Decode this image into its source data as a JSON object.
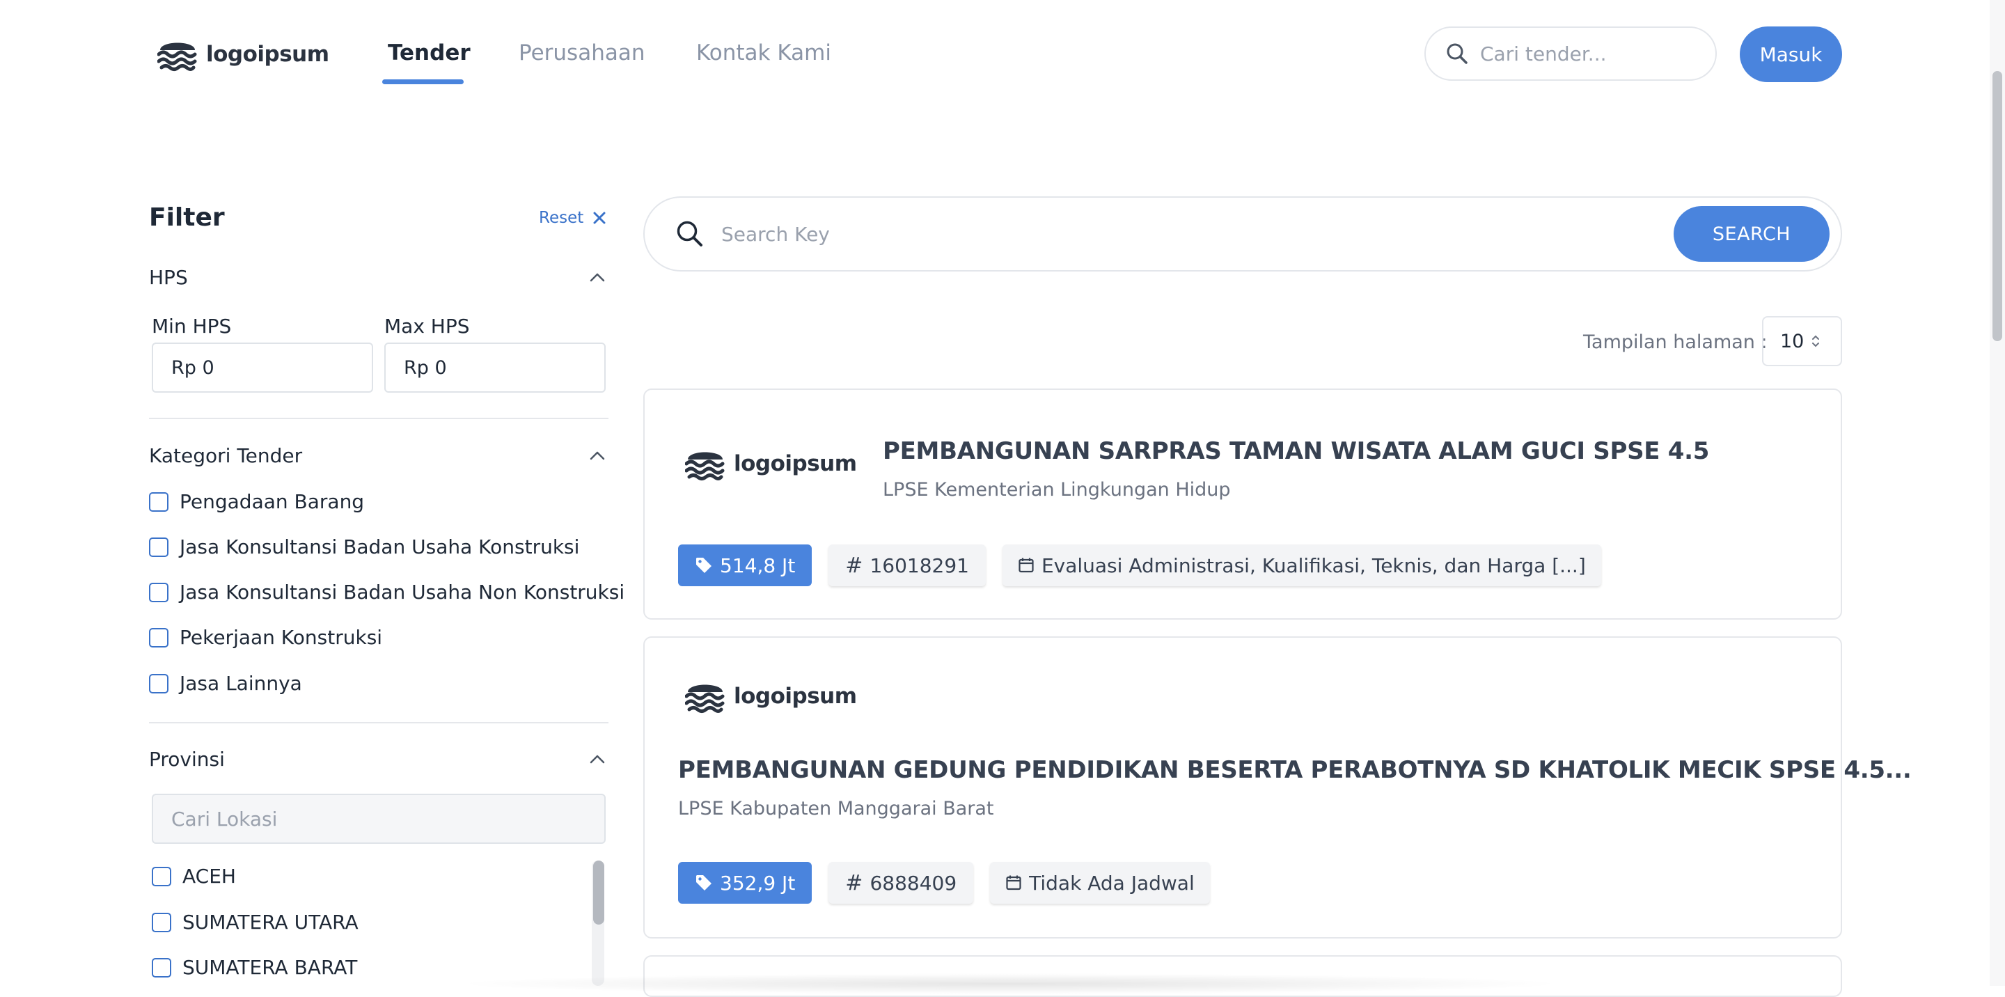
{
  "header": {
    "logo_text": "logoipsum",
    "nav": [
      {
        "label": "Tender",
        "active": true
      },
      {
        "label": "Perusahaan",
        "active": false
      },
      {
        "label": "Kontak Kami",
        "active": false
      }
    ],
    "search_placeholder": "Cari tender...",
    "login_label": "Masuk",
    "accent_color": "#4a84dd"
  },
  "filter": {
    "title": "Filter",
    "reset_label": "Reset",
    "hps": {
      "label": "HPS",
      "min_label": "Min HPS",
      "min_value": "Rp 0",
      "max_label": "Max HPS",
      "max_value": "Rp 0"
    },
    "kategori": {
      "label": "Kategori Tender",
      "options": [
        "Pengadaan Barang",
        "Jasa Konsultansi Badan Usaha Konstruksi",
        "Jasa Konsultansi Badan Usaha Non Konstruksi",
        "Pekerjaan Konstruksi",
        "Jasa Lainnya"
      ]
    },
    "provinsi": {
      "label": "Provinsi",
      "search_placeholder": "Cari Lokasi",
      "options": [
        "ACEH",
        "SUMATERA UTARA",
        "SUMATERA BARAT"
      ]
    }
  },
  "main": {
    "search_placeholder": "Search Key",
    "search_button": "SEARCH",
    "page_size_label": "Tampilan halaman :",
    "page_size_value": "10",
    "results": [
      {
        "logo_text": "logoipsum",
        "title": "PEMBANGUNAN SARPRAS TAMAN WISATA ALAM GUCI SPSE 4.5",
        "agency": "LPSE Kementerian Lingkungan Hidup",
        "price": "514,8 Jt",
        "code": "16018291",
        "stage": "Evaluasi Administrasi, Kualifikasi, Teknis, dan Harga [...]"
      },
      {
        "logo_text": "logoipsum",
        "title": "PEMBANGUNAN GEDUNG PENDIDIKAN BESERTA PERABOTNYA SD KHATOLIK MECIK SPSE 4.5...",
        "agency": "LPSE Kabupaten Manggarai Barat",
        "price": "352,9 Jt",
        "code": "6888409",
        "stage": "Tidak Ada Jadwal"
      }
    ]
  }
}
